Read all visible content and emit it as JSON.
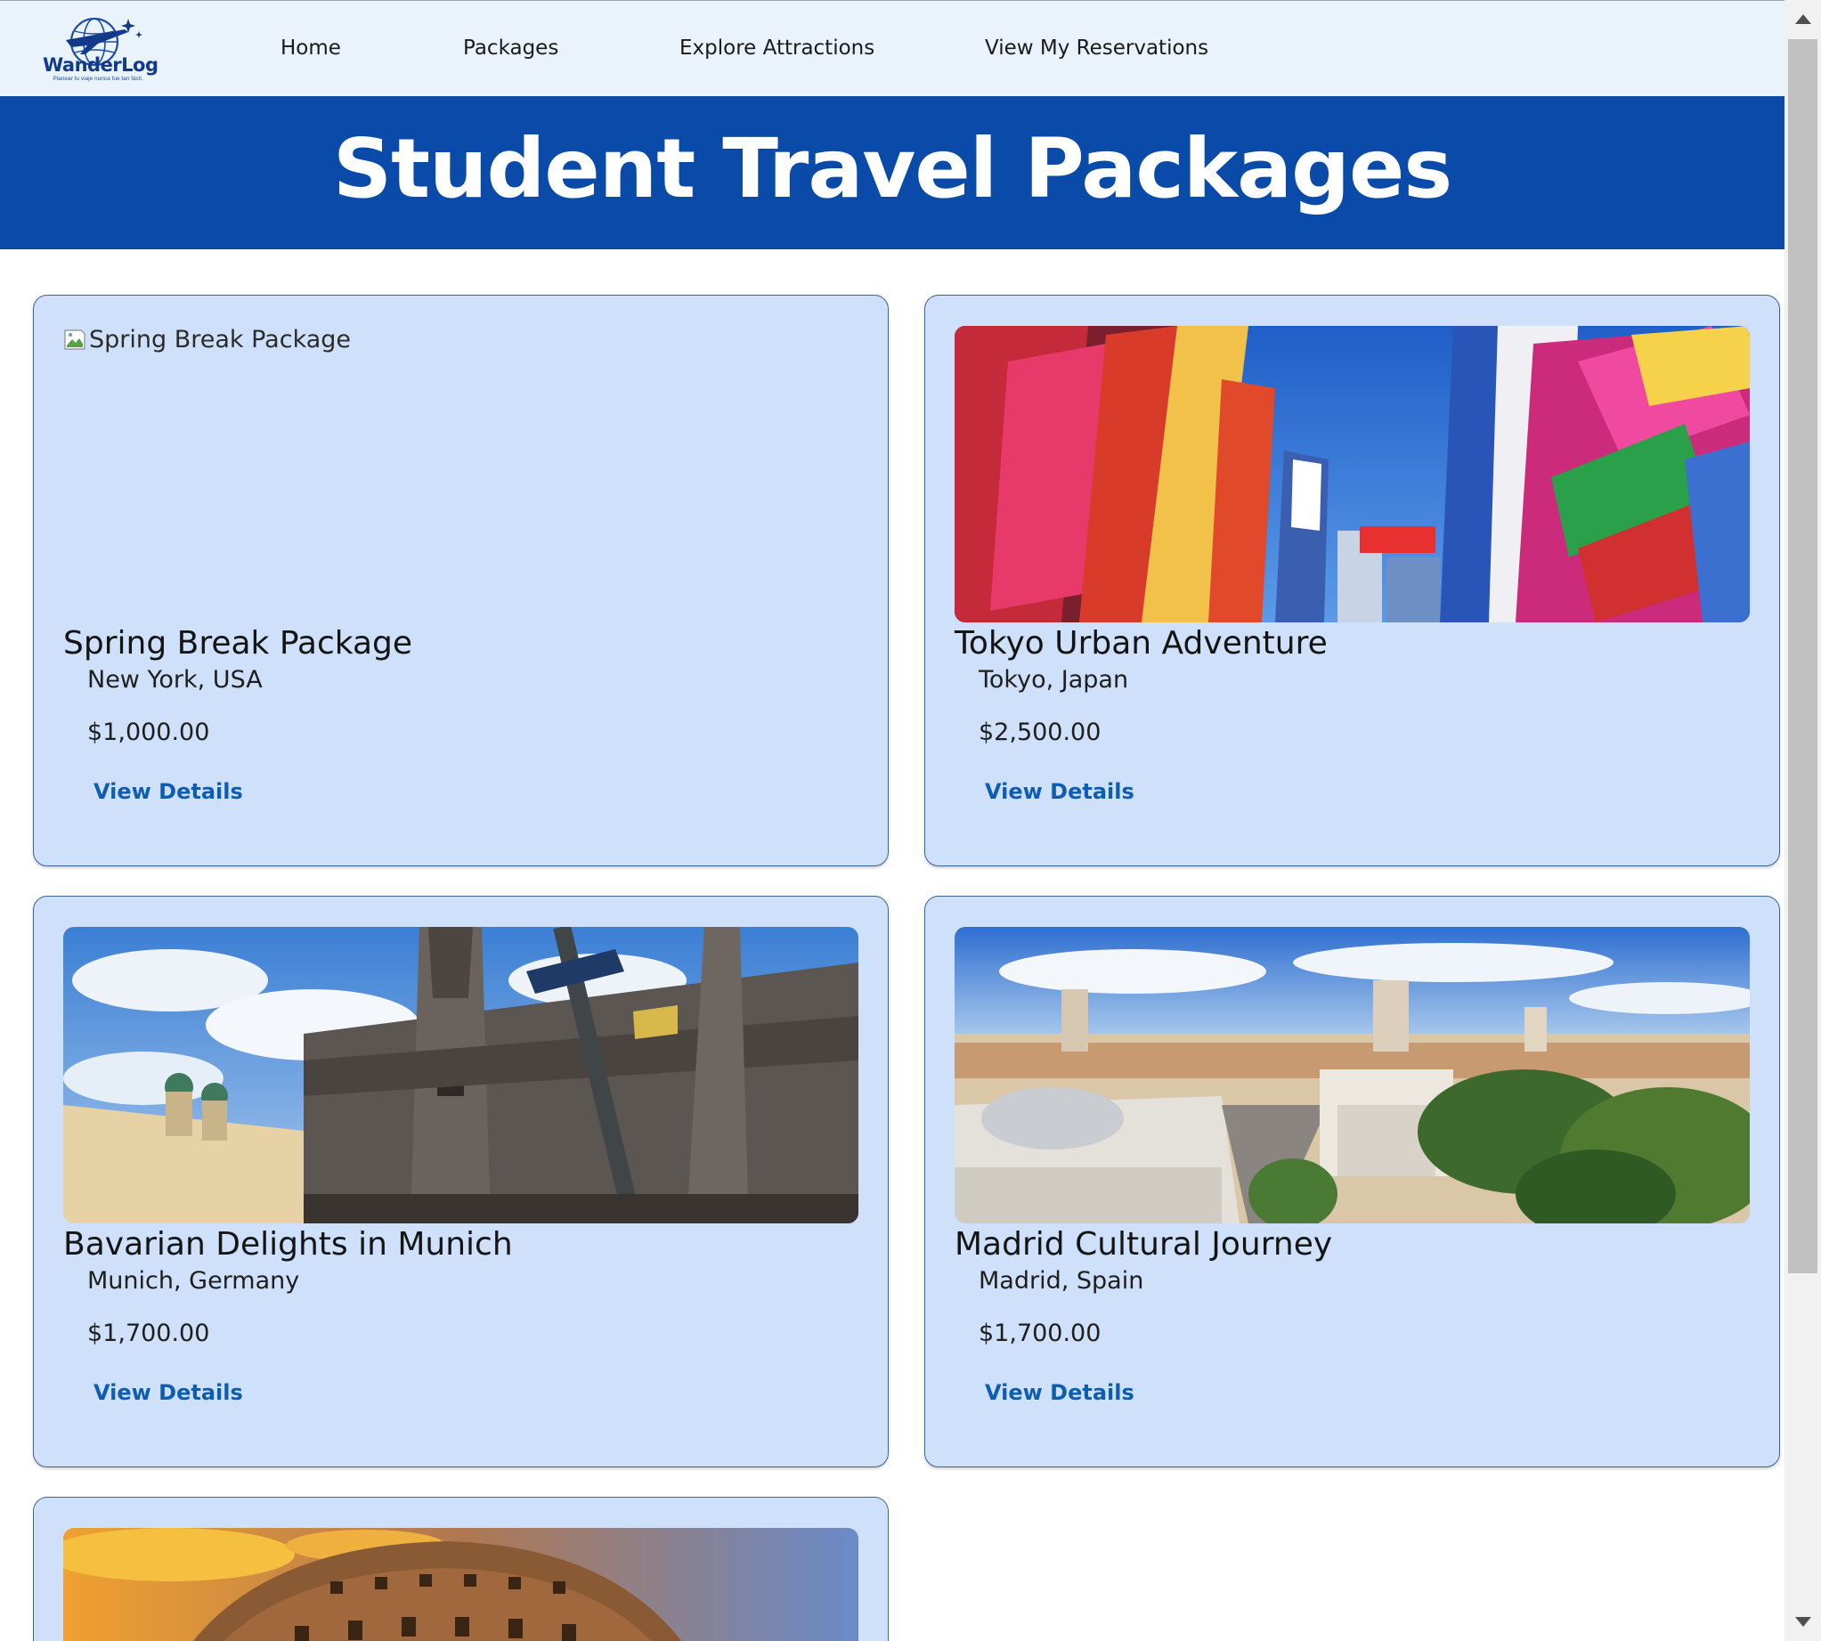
{
  "brand": {
    "name": "WanderLog",
    "tagline": "Planear tu viaje nunca fue tan fácil."
  },
  "nav": {
    "items": [
      {
        "label": "Home"
      },
      {
        "label": "Packages"
      },
      {
        "label": "Explore Attractions"
      },
      {
        "label": "View My Reservations"
      }
    ]
  },
  "hero": {
    "title": "Student Travel Packages"
  },
  "packages": [
    {
      "title": "Spring Break Package",
      "location": "New York, USA",
      "price": "$1,000.00",
      "link": "View Details",
      "image_alt": "Spring Break Package",
      "image": "broken-image"
    },
    {
      "title": "Tokyo Urban Adventure",
      "location": "Tokyo, Japan",
      "price": "$2,500.00",
      "link": "View Details",
      "image": "akihabara-street-photo"
    },
    {
      "title": "Bavarian Delights in Munich",
      "location": "Munich, Germany",
      "price": "$1,700.00",
      "link": "View Details",
      "image": "marienplatz-town-hall-photo"
    },
    {
      "title": "Madrid Cultural Journey",
      "location": "Madrid, Spain",
      "price": "$1,700.00",
      "link": "View Details",
      "image": "madrid-cityscape-photo"
    },
    {
      "image": "colosseum-sunset-photo"
    }
  ],
  "colors": {
    "nav_bg": "#eaf2fc",
    "hero_bg": "#0a4aa8",
    "card_bg": "#cfe1fa",
    "card_border": "#3f6494",
    "link": "#0e5db0"
  }
}
